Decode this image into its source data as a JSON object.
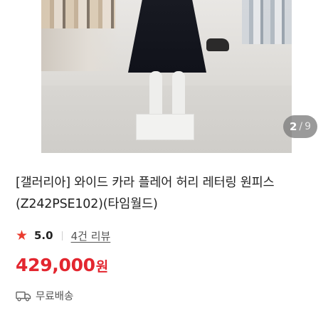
{
  "gallery": {
    "current": "2",
    "separator": "/",
    "total": "9"
  },
  "product": {
    "title": "[갤러리아] 와이드 카라 플레어 허리 레터링 원피스 (Z242PSE102)(타임월드)",
    "rating": "5.0",
    "review_link": "4건 리뷰",
    "price_amount": "429,000",
    "price_unit": "원",
    "shipping": "무료배송"
  },
  "icons": {
    "rating": "star-icon",
    "shipping": "truck-icon"
  },
  "colors": {
    "price": "#e3262f",
    "star": "#ea3b2e",
    "counter_bg": "rgba(120,120,120,0.75)"
  }
}
